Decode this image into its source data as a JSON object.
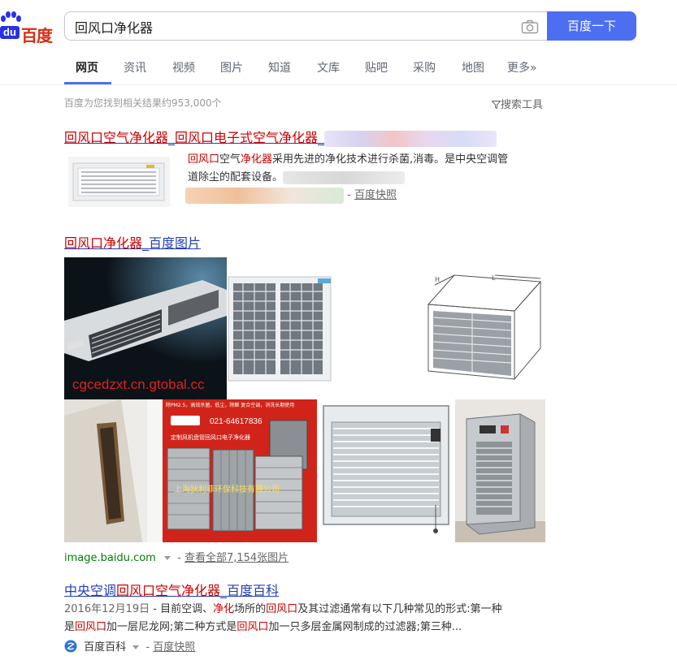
{
  "header": {
    "logo_du": "du",
    "logo_text": "百度",
    "search_value": "回风口净化器",
    "search_button": "百度一下"
  },
  "tabs": [
    {
      "label": "网页"
    },
    {
      "label": "资讯"
    },
    {
      "label": "视频"
    },
    {
      "label": "图片"
    },
    {
      "label": "知道"
    },
    {
      "label": "文库"
    },
    {
      "label": "贴吧"
    },
    {
      "label": "采购"
    },
    {
      "label": "地图"
    },
    {
      "label": "更多»"
    }
  ],
  "result_count": "百度为您找到相关结果约953,000个",
  "search_tools": "搜索工具",
  "results": [
    {
      "title_a": "回风口",
      "title_b": "空气净化器",
      "title_c": "_",
      "title_d": "回风口",
      "title_e": "电子式空气净化器",
      "title_f": "_",
      "desc1_a": "回风口",
      "desc1_b": "空气",
      "desc1_c": "净化器",
      "desc1_d": "采用先进的净化技术进行杀菌,消毒。是中央空调管",
      "desc2": "道除尘的配套设备。",
      "snapshot": "百度快照",
      "dash": "-"
    }
  ],
  "image_block": {
    "title_a": "回风口净化器",
    "title_b": "_百度图片",
    "watermark": "cgcedzxt.cn.gtobal.cc",
    "ad_phone": "021-64617836",
    "ad_line": "定制风机盘管回风口电子净化器",
    "ad_company": "上海狄利菲环保科技有限公司",
    "ad_top": "除PM2.5，高效杀菌，低尘，除醛  复合空调，消洗长期使用",
    "source": "image.baidu.com",
    "more": "查看全部7,154张图片",
    "dash": "-"
  },
  "baike": {
    "title_a": "中央空调",
    "title_b": "回风口",
    "title_c": "空气净化器",
    "title_d": "_百度百科",
    "date": "2016年12月19日",
    "line1_a": " - 目前空调、",
    "line1_b": "净化",
    "line1_c": "场所的",
    "line1_d": "回风口",
    "line1_e": "及其过滤通常有以下几种常见的形式:第一种",
    "line2_a": "是",
    "line2_b": "回风口",
    "line2_c": "加一层尼龙网;第二种方式是",
    "line2_d": "回风口",
    "line2_e": "加一只多层金属网制成的过滤器;第三种...",
    "source": "百度百科",
    "dash": "-",
    "snapshot": "百度快照"
  },
  "colors": {
    "accent": "#4e6ef2",
    "link": "#2440b3",
    "highlight": "#cc0000"
  }
}
